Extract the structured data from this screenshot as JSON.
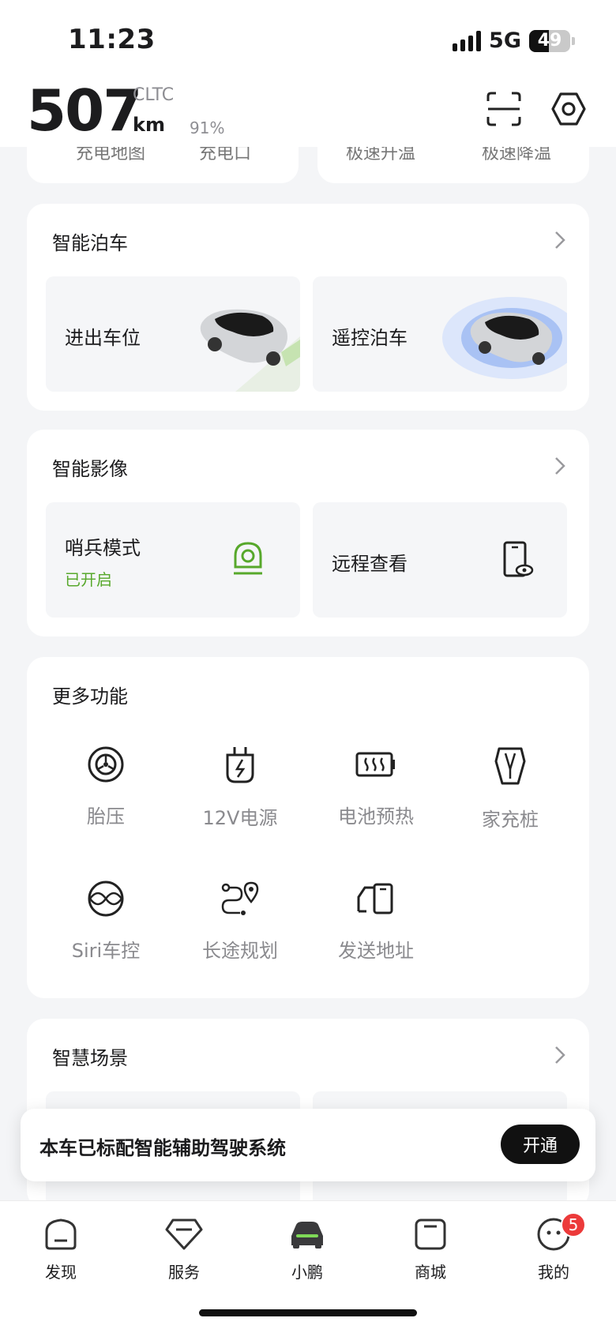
{
  "status_bar": {
    "time": "11:23",
    "network": "5G",
    "battery_level": "49",
    "battery_fraction": 0.49
  },
  "header": {
    "range_value": "507",
    "range_standard": "CLTC",
    "range_unit": "km",
    "battery_percent": "91%"
  },
  "partial_card": {
    "items": [
      "充电地图",
      "充电口",
      "极速升温",
      "极速降温"
    ]
  },
  "smart_parking": {
    "title": "智能泊车",
    "tiles": [
      {
        "label": "进出车位"
      },
      {
        "label": "遥控泊车"
      }
    ]
  },
  "smart_camera": {
    "title": "智能影像",
    "tiles": [
      {
        "label": "哨兵模式",
        "status": "已开启"
      },
      {
        "label": "远程查看"
      }
    ]
  },
  "more_functions": {
    "title": "更多功能",
    "items": [
      {
        "label": "胎压",
        "icon": "tire-icon"
      },
      {
        "label": "12V电源",
        "icon": "plug-icon"
      },
      {
        "label": "电池预热",
        "icon": "battery-heat-icon"
      },
      {
        "label": "家充桩",
        "icon": "home-charger-icon"
      },
      {
        "label": "Siri车控",
        "icon": "siri-icon"
      },
      {
        "label": "长途规划",
        "icon": "route-icon"
      },
      {
        "label": "发送地址",
        "icon": "send-address-icon"
      }
    ]
  },
  "smart_scene": {
    "title": "智慧场景"
  },
  "banner": {
    "text": "本车已标配智能辅助驾驶系统",
    "button": "开通"
  },
  "tabbar": {
    "items": [
      {
        "label": "发现",
        "icon": "discover-icon"
      },
      {
        "label": "服务",
        "icon": "service-icon"
      },
      {
        "label": "小鹏",
        "icon": "car-icon"
      },
      {
        "label": "商城",
        "icon": "shop-icon"
      },
      {
        "label": "我的",
        "icon": "profile-icon",
        "badge": "5"
      }
    ]
  },
  "colors": {
    "accent_green": "#57a82b",
    "badge_red": "#ec3a3a",
    "background": "#f4f5f7"
  }
}
